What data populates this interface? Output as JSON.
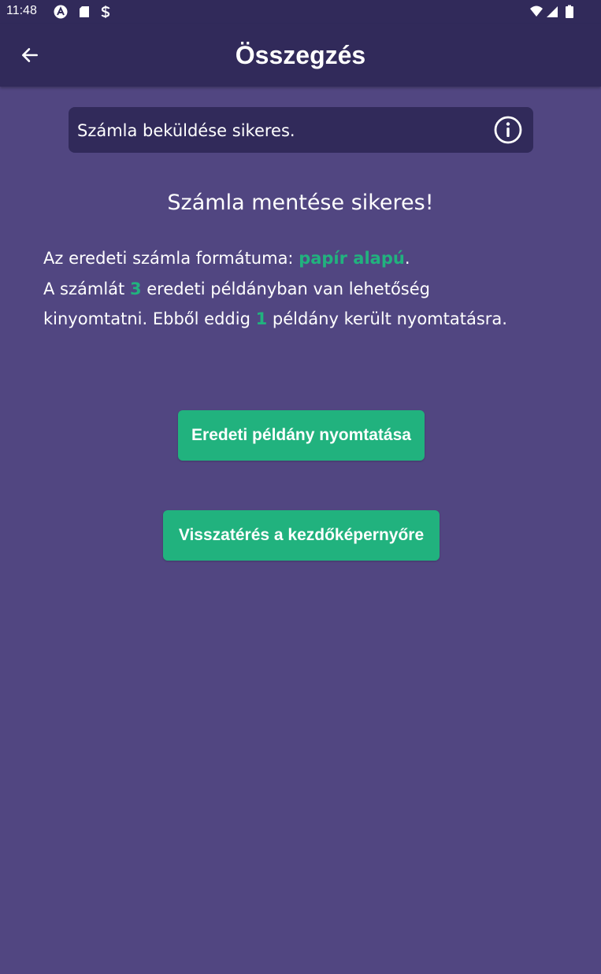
{
  "status_bar": {
    "time": "11:48",
    "left_icons": [
      "a-circle-icon",
      "sd-card-icon",
      "s-sync-icon"
    ],
    "right_icons": [
      "wifi-icon",
      "signal-icon",
      "battery-icon"
    ]
  },
  "app_bar": {
    "title": "Összegzés",
    "back_icon": "arrow-left-icon"
  },
  "toast": {
    "message": "Számla beküldése sikeres.",
    "icon": "info-icon"
  },
  "main": {
    "heading": "Számla mentése sikeres!",
    "format_prefix": "Az eredeti számla formátuma: ",
    "format_value": "papír alapú",
    "format_suffix": ".",
    "copies_prefix": "A számlát ",
    "copies_total": "3",
    "copies_middle": " eredeti példányban van lehetőség kinyomtatni. Ebből eddig ",
    "copies_printed": "1",
    "copies_suffix": " példány került nyomtatásra."
  },
  "buttons": {
    "print_original": "Eredeti példány nyomtatása",
    "back_home": "Visszatérés a kezdőképernyőre"
  },
  "colors": {
    "background": "#514681",
    "bar": "#312a5a",
    "accent": "#21b27e"
  }
}
